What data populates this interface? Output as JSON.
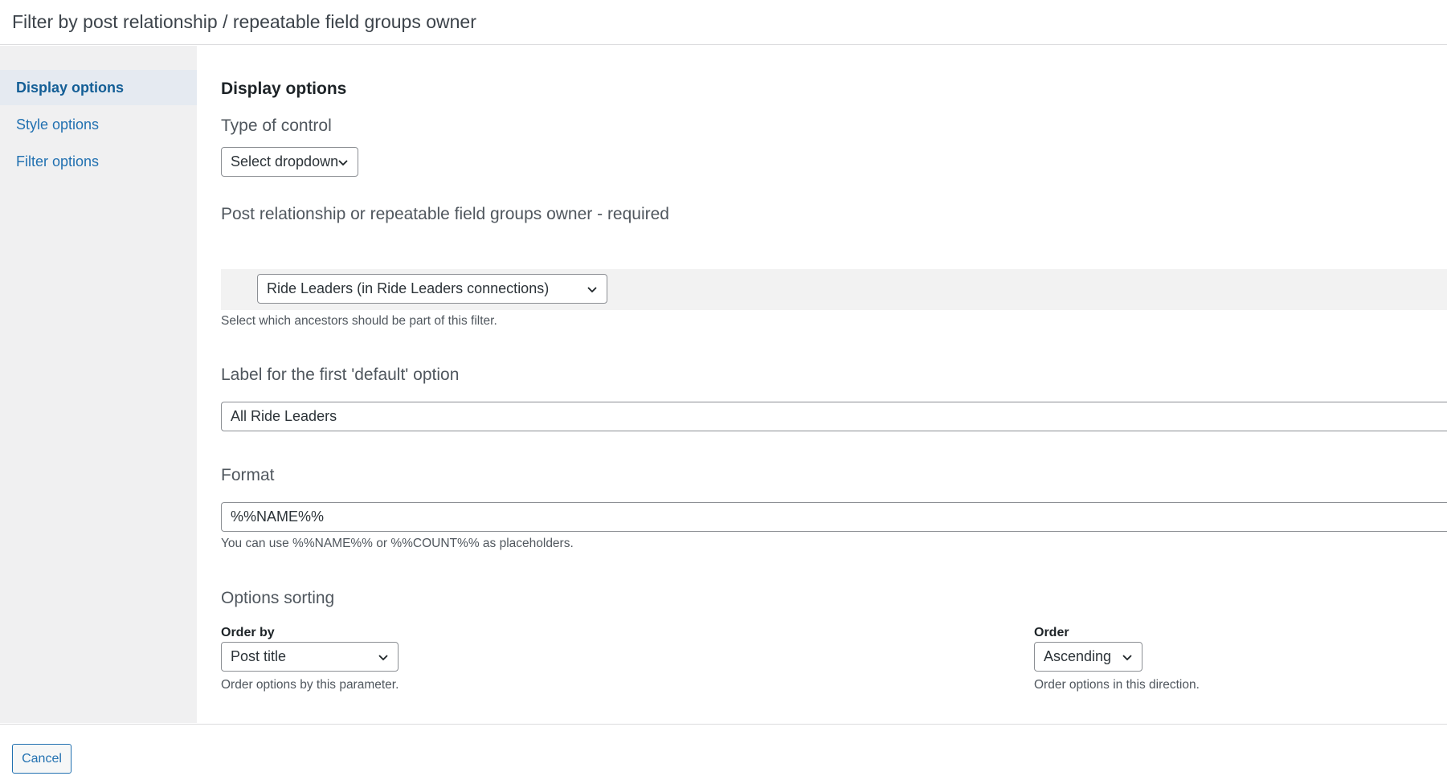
{
  "dialog": {
    "title": "Filter by post relationship / repeatable field groups owner"
  },
  "sidebar": {
    "items": [
      {
        "label": "Display options",
        "active": true
      },
      {
        "label": "Style options",
        "active": false
      },
      {
        "label": "Filter options",
        "active": false
      }
    ]
  },
  "main": {
    "section_heading": "Display options",
    "type_of_control": {
      "label": "Type of control",
      "selected": "Select dropdown"
    },
    "relationship": {
      "label": "Post relationship or repeatable field groups owner - required",
      "selected": "Ride Leaders (in Ride Leaders connections)",
      "help": "Select which ancestors should be part of this filter."
    },
    "default_label": {
      "label": "Label for the first 'default' option",
      "value": "All Ride Leaders"
    },
    "format": {
      "label": "Format",
      "value": "%%NAME%%",
      "help": "You can use %%NAME%% or %%COUNT%% as placeholders."
    },
    "options_sorting": {
      "label": "Options sorting",
      "order_by": {
        "label": "Order by",
        "selected": "Post title",
        "help": "Order options by this parameter."
      },
      "order": {
        "label": "Order",
        "selected": "Ascending",
        "help": "Order options in this direction."
      }
    }
  },
  "footer": {
    "cancel_label": "Cancel"
  },
  "colors": {
    "link": "#2271b1",
    "sidebar_bg": "#f0f0f1",
    "active_item_bg": "#e5eaf1"
  }
}
